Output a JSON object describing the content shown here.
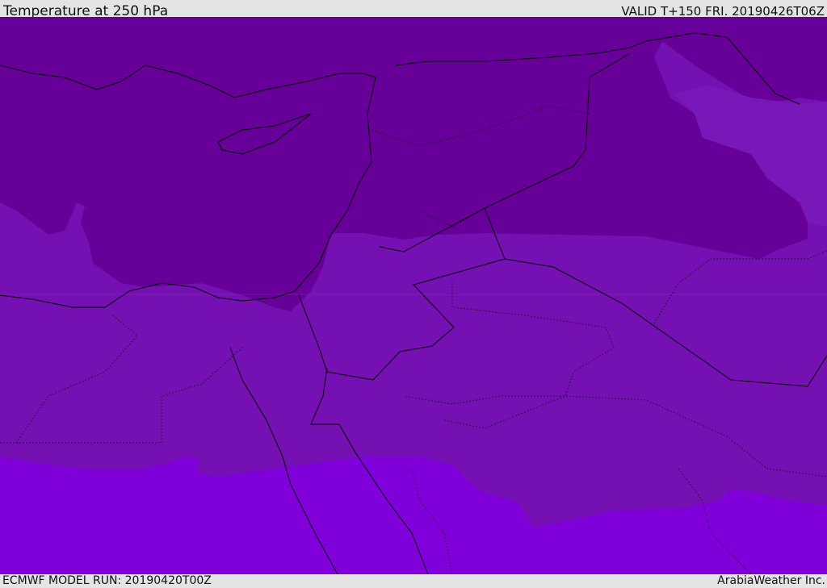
{
  "header": {
    "title": "Temperature at 250 hPa",
    "valid": "VALID T+150 FRI. 20190426T06Z"
  },
  "footer": {
    "model_run": "ECMWF MODEL RUN: 20190420T00Z",
    "credit": "ArabiaWeather Inc."
  },
  "colors": {
    "cold": "#660099",
    "mid": "#7510b2",
    "warm": "#7f00d9",
    "band_light": "#7a1ab8"
  }
}
